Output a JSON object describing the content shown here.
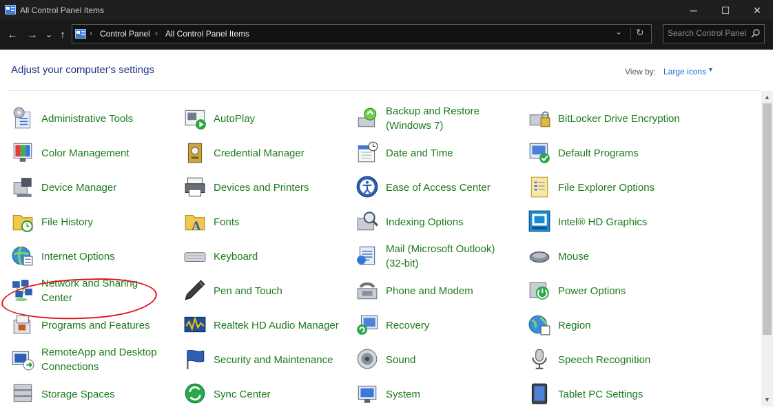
{
  "window": {
    "title": "All Control Panel Items",
    "minimize_glyph": "─",
    "maximize_glyph": "☐",
    "close_glyph": "✕"
  },
  "nav": {
    "back_glyph": "←",
    "forward_glyph": "→",
    "recent_glyph": "⌄",
    "up_glyph": "↑",
    "breadcrumb_sep": "›",
    "breadcrumb": [
      "Control Panel",
      "All Control Panel Items"
    ],
    "address_dropdown_glyph": "⌄",
    "refresh_glyph": "↻",
    "search_placeholder": "Search Control Panel"
  },
  "header": {
    "heading": "Adjust your computer's settings",
    "view_by_label": "View by:",
    "view_by_value": "Large icons",
    "view_by_caret": "▼"
  },
  "scrollbar": {
    "up_glyph": "▲",
    "down_glyph": "▼"
  },
  "items": [
    {
      "label": "Administrative Tools",
      "icon": "admin-tools-icon"
    },
    {
      "label": "AutoPlay",
      "icon": "autoplay-icon"
    },
    {
      "label": "Backup and Restore\n(Windows 7)",
      "icon": "backup-restore-icon"
    },
    {
      "label": "BitLocker Drive Encryption",
      "icon": "bitlocker-icon"
    },
    {
      "label": "Color Management",
      "icon": "color-management-icon"
    },
    {
      "label": "Credential Manager",
      "icon": "credential-manager-icon"
    },
    {
      "label": "Date and Time",
      "icon": "date-time-icon"
    },
    {
      "label": "Default Programs",
      "icon": "default-programs-icon"
    },
    {
      "label": "Device Manager",
      "icon": "device-manager-icon"
    },
    {
      "label": "Devices and Printers",
      "icon": "devices-printers-icon"
    },
    {
      "label": "Ease of Access Center",
      "icon": "ease-of-access-icon"
    },
    {
      "label": "File Explorer Options",
      "icon": "file-explorer-options-icon"
    },
    {
      "label": "File History",
      "icon": "file-history-icon"
    },
    {
      "label": "Fonts",
      "icon": "fonts-icon"
    },
    {
      "label": "Indexing Options",
      "icon": "indexing-options-icon"
    },
    {
      "label": "Intel® HD Graphics",
      "icon": "intel-graphics-icon"
    },
    {
      "label": "Internet Options",
      "icon": "internet-options-icon"
    },
    {
      "label": "Keyboard",
      "icon": "keyboard-icon"
    },
    {
      "label": "Mail (Microsoft Outlook)\n(32-bit)",
      "icon": "mail-icon"
    },
    {
      "label": "Mouse",
      "icon": "mouse-icon"
    },
    {
      "label": "Network and Sharing\nCenter",
      "icon": "network-sharing-icon"
    },
    {
      "label": "Pen and Touch",
      "icon": "pen-touch-icon"
    },
    {
      "label": "Phone and Modem",
      "icon": "phone-modem-icon"
    },
    {
      "label": "Power Options",
      "icon": "power-options-icon"
    },
    {
      "label": "Programs and Features",
      "icon": "programs-features-icon"
    },
    {
      "label": "Realtek HD Audio Manager",
      "icon": "realtek-audio-icon"
    },
    {
      "label": "Recovery",
      "icon": "recovery-icon"
    },
    {
      "label": "Region",
      "icon": "region-icon"
    },
    {
      "label": "RemoteApp and Desktop\nConnections",
      "icon": "remoteapp-icon"
    },
    {
      "label": "Security and Maintenance",
      "icon": "security-maintenance-icon"
    },
    {
      "label": "Sound",
      "icon": "sound-icon"
    },
    {
      "label": "Speech Recognition",
      "icon": "speech-recognition-icon"
    },
    {
      "label": "Storage Spaces",
      "icon": "storage-spaces-icon"
    },
    {
      "label": "Sync Center",
      "icon": "sync-center-icon"
    },
    {
      "label": "System",
      "icon": "system-icon"
    },
    {
      "label": "Tablet PC Settings",
      "icon": "tablet-pc-icon"
    }
  ]
}
